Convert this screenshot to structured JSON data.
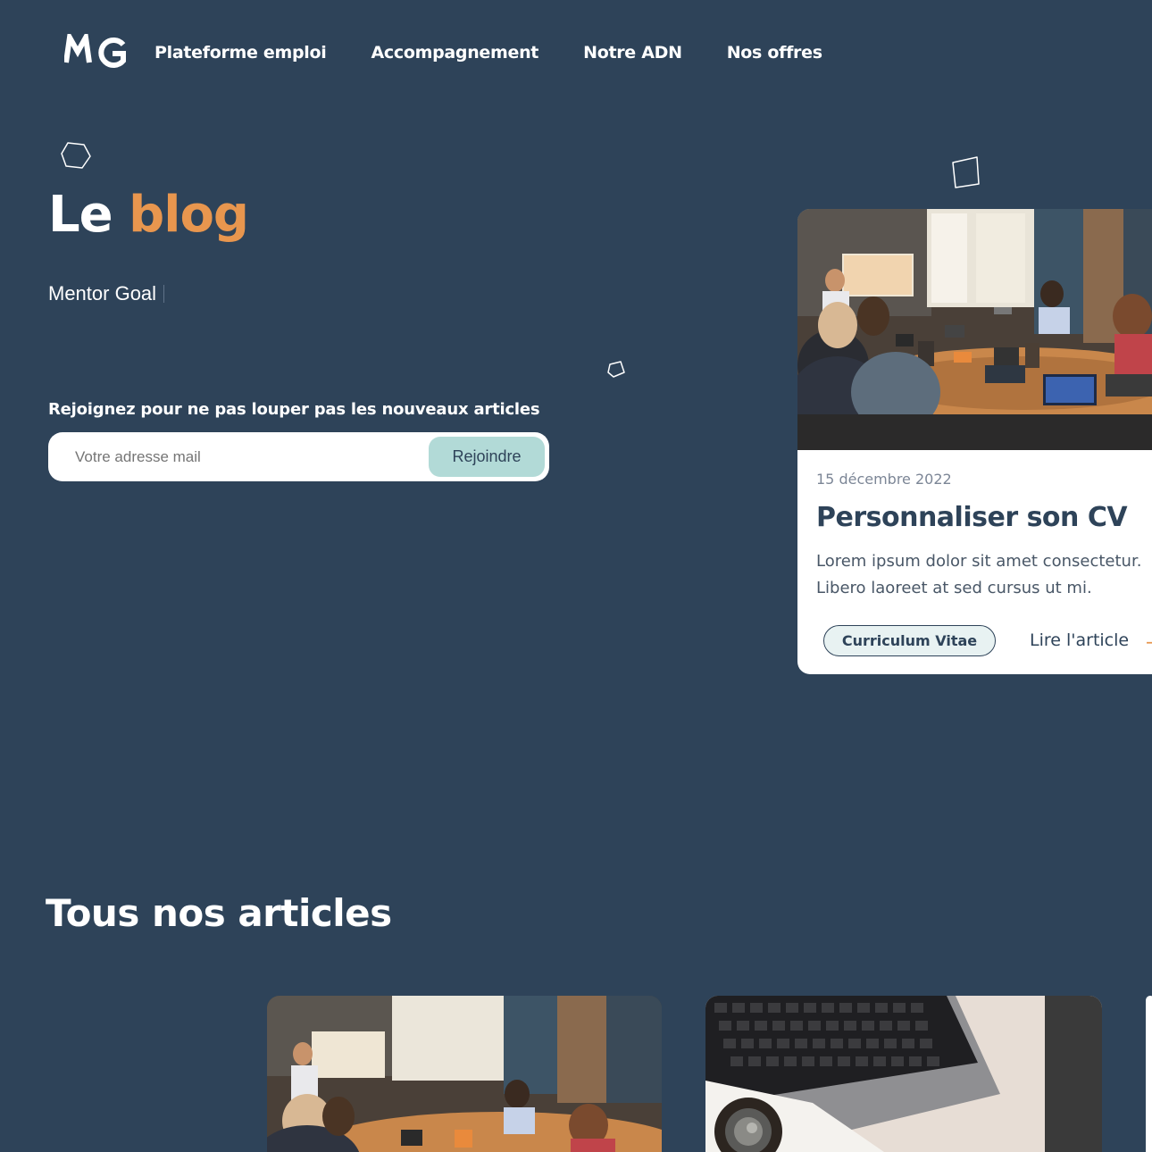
{
  "header": {
    "logo_text": "MG",
    "nav": [
      {
        "label": "Plateforme emploi"
      },
      {
        "label": "Accompagnement"
      },
      {
        "label": "Notre ADN"
      },
      {
        "label": "Nos offres"
      }
    ]
  },
  "hero": {
    "title_part1": "Le",
    "title_part2": "blog",
    "subtitle": "Mentor Goal"
  },
  "newsletter": {
    "label": "Rejoignez pour ne pas louper pas les nouveaux articles",
    "placeholder": "Votre adresse mail",
    "button_label": "Rejoindre"
  },
  "featured_article": {
    "date": "15 décembre 2022",
    "title": "Personnaliser son CV",
    "excerpt": "Lorem ipsum dolor sit amet consectetur. Libero laoreet at sed cursus ut mi.",
    "tag": "Curriculum Vitae",
    "read_label": "Lire l'article",
    "arrow_icon": "arrow-right-icon"
  },
  "articles_section": {
    "title": "Tous nos articles"
  },
  "colors": {
    "background": "#2e4359",
    "accent": "#e8964e",
    "button": "#b2dad7"
  }
}
